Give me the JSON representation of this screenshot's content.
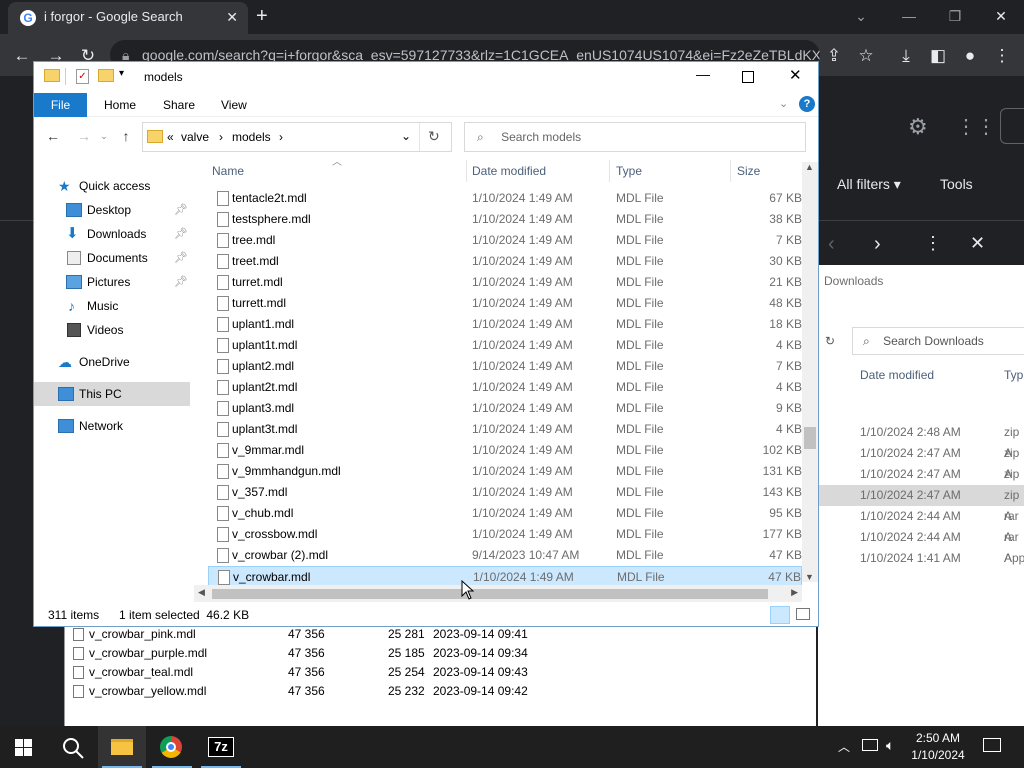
{
  "chrome": {
    "tab_title": "i forgor - Google Search",
    "url": "google.com/search?q=i+forgor&sca_esv=597127733&rlz=1C1GCEA_enUS1074US1074&ei=Fz2eZeTBLdKX...",
    "all_filters": "All filters",
    "tools": "Tools",
    "favicon_letter": "G"
  },
  "downloads_bg": {
    "title": "Downloads",
    "search_placeholder": "Search Downloads",
    "col_date": "Date modified",
    "col_type": "Typ",
    "rows": [
      {
        "date": "1/10/2024 2:48 AM",
        "type": "zip A"
      },
      {
        "date": "1/10/2024 2:47 AM",
        "type": "zip A"
      },
      {
        "date": "1/10/2024 2:47 AM",
        "type": "zip A"
      },
      {
        "date": "1/10/2024 2:47 AM",
        "type": "zip A"
      },
      {
        "date": "1/10/2024 2:44 AM",
        "type": "rar A"
      },
      {
        "date": "1/10/2024 2:44 AM",
        "type": "rar A"
      },
      {
        "date": "1/10/2024 1:41 AM",
        "type": "App"
      }
    ]
  },
  "archive_bg": {
    "rows": [
      {
        "name": "v_crowbar_pink.mdl",
        "size": "47 356",
        "packed": "25 281",
        "modified": "2023-09-14 09:41"
      },
      {
        "name": "v_crowbar_purple.mdl",
        "size": "47 356",
        "packed": "25 185",
        "modified": "2023-09-14 09:34"
      },
      {
        "name": "v_crowbar_teal.mdl",
        "size": "47 356",
        "packed": "25 254",
        "modified": "2023-09-14 09:43"
      },
      {
        "name": "v_crowbar_yellow.mdl",
        "size": "47 356",
        "packed": "25 232",
        "modified": "2023-09-14 09:42"
      }
    ]
  },
  "explorer": {
    "title": "models",
    "ribbon": {
      "file": "File",
      "home": "Home",
      "share": "Share",
      "view": "View"
    },
    "breadcrumb": [
      "«",
      "valve",
      "›",
      "models",
      "›"
    ],
    "search_placeholder": "Search models",
    "nav": {
      "quick_access": "Quick access",
      "desktop": "Desktop",
      "downloads": "Downloads",
      "documents": "Documents",
      "pictures": "Pictures",
      "music": "Music",
      "videos": "Videos",
      "onedrive": "OneDrive",
      "this_pc": "This PC",
      "network": "Network"
    },
    "columns": {
      "name": "Name",
      "date": "Date modified",
      "type": "Type",
      "size": "Size"
    },
    "files": [
      {
        "name": "tentacle2t.mdl",
        "date": "1/10/2024 1:49 AM",
        "type": "MDL File",
        "size": "67 KB"
      },
      {
        "name": "testsphere.mdl",
        "date": "1/10/2024 1:49 AM",
        "type": "MDL File",
        "size": "38 KB"
      },
      {
        "name": "tree.mdl",
        "date": "1/10/2024 1:49 AM",
        "type": "MDL File",
        "size": "7 KB"
      },
      {
        "name": "treet.mdl",
        "date": "1/10/2024 1:49 AM",
        "type": "MDL File",
        "size": "30 KB"
      },
      {
        "name": "turret.mdl",
        "date": "1/10/2024 1:49 AM",
        "type": "MDL File",
        "size": "21 KB"
      },
      {
        "name": "turrett.mdl",
        "date": "1/10/2024 1:49 AM",
        "type": "MDL File",
        "size": "48 KB"
      },
      {
        "name": "uplant1.mdl",
        "date": "1/10/2024 1:49 AM",
        "type": "MDL File",
        "size": "18 KB"
      },
      {
        "name": "uplant1t.mdl",
        "date": "1/10/2024 1:49 AM",
        "type": "MDL File",
        "size": "4 KB"
      },
      {
        "name": "uplant2.mdl",
        "date": "1/10/2024 1:49 AM",
        "type": "MDL File",
        "size": "7 KB"
      },
      {
        "name": "uplant2t.mdl",
        "date": "1/10/2024 1:49 AM",
        "type": "MDL File",
        "size": "4 KB"
      },
      {
        "name": "uplant3.mdl",
        "date": "1/10/2024 1:49 AM",
        "type": "MDL File",
        "size": "9 KB"
      },
      {
        "name": "uplant3t.mdl",
        "date": "1/10/2024 1:49 AM",
        "type": "MDL File",
        "size": "4 KB"
      },
      {
        "name": "v_9mmar.mdl",
        "date": "1/10/2024 1:49 AM",
        "type": "MDL File",
        "size": "102 KB"
      },
      {
        "name": "v_9mmhandgun.mdl",
        "date": "1/10/2024 1:49 AM",
        "type": "MDL File",
        "size": "131 KB"
      },
      {
        "name": "v_357.mdl",
        "date": "1/10/2024 1:49 AM",
        "type": "MDL File",
        "size": "143 KB"
      },
      {
        "name": "v_chub.mdl",
        "date": "1/10/2024 1:49 AM",
        "type": "MDL File",
        "size": "95 KB"
      },
      {
        "name": "v_crossbow.mdl",
        "date": "1/10/2024 1:49 AM",
        "type": "MDL File",
        "size": "177 KB"
      },
      {
        "name": "v_crowbar (2).mdl",
        "date": "9/14/2023 10:47 AM",
        "type": "MDL File",
        "size": "47 KB"
      },
      {
        "name": "v_crowbar.mdl",
        "date": "1/10/2024 1:49 AM",
        "type": "MDL File",
        "size": "47 KB",
        "selected": true
      }
    ],
    "status": {
      "count": "311 items",
      "selected": "1 item selected  46.2 KB"
    }
  },
  "taskbar": {
    "time": "2:50 AM",
    "date": "1/10/2024",
    "sevenzip_label": "7z"
  },
  "colors": {
    "accent": "#1979ca",
    "selection": "#cce8ff",
    "chrome_dark": "#202124"
  }
}
